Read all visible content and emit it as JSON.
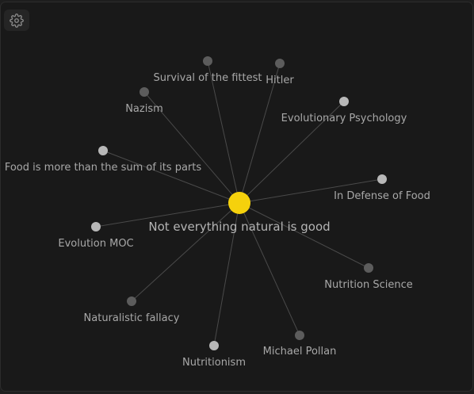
{
  "colors": {
    "center_node": "#f5d10c",
    "node_light": "#b8b8b8",
    "node_dark": "#5c5c5c"
  },
  "center": {
    "label": "Not everything natural is good"
  },
  "nodes": [
    {
      "label": "Survival of the fittest",
      "tone": "dark"
    },
    {
      "label": "Hitler",
      "tone": "dark"
    },
    {
      "label": "Nazism",
      "tone": "dark"
    },
    {
      "label": "Evolutionary Psychology",
      "tone": "light"
    },
    {
      "label": "Food is more than the sum of its parts",
      "tone": "light"
    },
    {
      "label": "In Defense of Food",
      "tone": "light"
    },
    {
      "label": "Evolution MOC",
      "tone": "light"
    },
    {
      "label": "Nutrition Science",
      "tone": "dark"
    },
    {
      "label": "Naturalistic fallacy",
      "tone": "dark"
    },
    {
      "label": "Michael Pollan",
      "tone": "dark"
    },
    {
      "label": "Nutritionism",
      "tone": "light"
    }
  ],
  "toolbar": {
    "settings_icon": "gear-icon"
  }
}
